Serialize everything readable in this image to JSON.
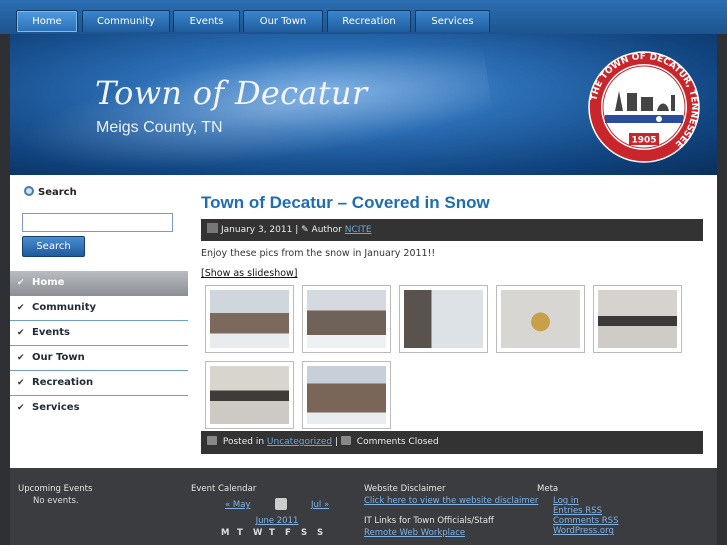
{
  "nav": {
    "tabs": [
      {
        "label": "Home",
        "active": true
      },
      {
        "label": "Community"
      },
      {
        "label": "Events"
      },
      {
        "label": "Our Town"
      },
      {
        "label": "Recreation"
      },
      {
        "label": "Services"
      }
    ]
  },
  "header": {
    "title": "Town of Decatur",
    "subtitle": "Meigs County, TN",
    "seal": {
      "ring_text": "THE TOWN OF DECATUR, TENNESSEE",
      "year": "1905",
      "colors": {
        "outer": "#c9262c",
        "inner": "#ffffff",
        "band": "#2a4d9b"
      }
    }
  },
  "sidebar": {
    "search_heading": "Search",
    "search_value": "",
    "search_button": "Search",
    "items": [
      {
        "label": "Home",
        "active": true
      },
      {
        "label": "Community"
      },
      {
        "label": "Events"
      },
      {
        "label": "Our Town"
      },
      {
        "label": "Recreation"
      },
      {
        "label": "Services"
      }
    ]
  },
  "post": {
    "title": "Town of Decatur – Covered in Snow",
    "date": "January 3, 2011",
    "author_prefix": "Author",
    "author": "NCITE",
    "intro": "Enjoy these pics from the snow in January 2011!!",
    "slideshow_link": "[Show as slideshow]",
    "thumbnails": [
      {
        "name": "snow-courthouse-front"
      },
      {
        "name": "snow-building-side"
      },
      {
        "name": "snow-entrance"
      },
      {
        "name": "building-seal"
      },
      {
        "name": "municipal-building-sign"
      },
      {
        "name": "municipal-building-sign-2"
      },
      {
        "name": "snow-courthouse-2"
      }
    ],
    "posted_in_prefix": "Posted in",
    "category": "Uncategorized",
    "comments": "Comments Closed"
  },
  "footer": {
    "upcoming": {
      "heading": "Upcoming Events",
      "text": "No events."
    },
    "calendar": {
      "heading": "Event Calendar",
      "prev": "« May",
      "next": "Jul »",
      "month": "June 2011",
      "days": [
        "M",
        "T",
        "W",
        "T",
        "F",
        "S",
        "S"
      ]
    },
    "disclaimer": {
      "heading": "Website Disclaimer",
      "link": "Click here to view the website disclaimer",
      "it_heading": "IT Links for Town Officials/Staff",
      "it_link": "Remote Web Workplace"
    },
    "meta": {
      "heading": "Meta",
      "links": [
        "Log in",
        "Entries RSS",
        "Comments RSS",
        "WordPress.org"
      ]
    }
  }
}
